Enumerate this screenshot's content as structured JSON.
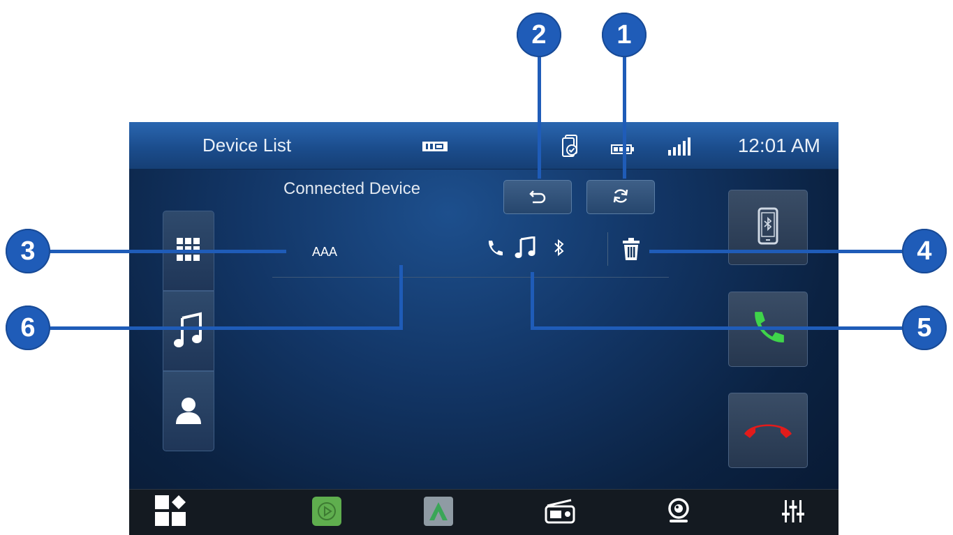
{
  "status_bar": {
    "title": "Device List",
    "time": "12:01 AM",
    "icons": [
      "usb-icon",
      "phone-sync-icon",
      "battery-icon",
      "signal-icon"
    ]
  },
  "section_title": "Connected Device",
  "toolbar": {
    "back_icon": "back-arrow-icon",
    "refresh_icon": "refresh-icon"
  },
  "device": {
    "name": "AAA",
    "profile_icons": [
      "phone-icon",
      "music-note-icon",
      "bluetooth-icon"
    ],
    "delete_icon": "trash-icon"
  },
  "left_menu": [
    "keypad-icon",
    "music-note-icon",
    "contact-icon"
  ],
  "right_menu": [
    "bluetooth-phone-icon",
    "call-answer-icon",
    "call-end-icon"
  ],
  "dock": [
    "home-apps-icon",
    "carplay-icon",
    "android-auto-icon",
    "radio-icon",
    "camera-icon",
    "equalizer-icon"
  ],
  "callouts": [
    "1",
    "2",
    "3",
    "4",
    "5",
    "6"
  ],
  "colors": {
    "callout": "#1f5cb8",
    "answer": "#3fd44a",
    "end_call": "#e21b1b",
    "carplay": "#5fae4e",
    "android_auto": "#3aa657"
  }
}
